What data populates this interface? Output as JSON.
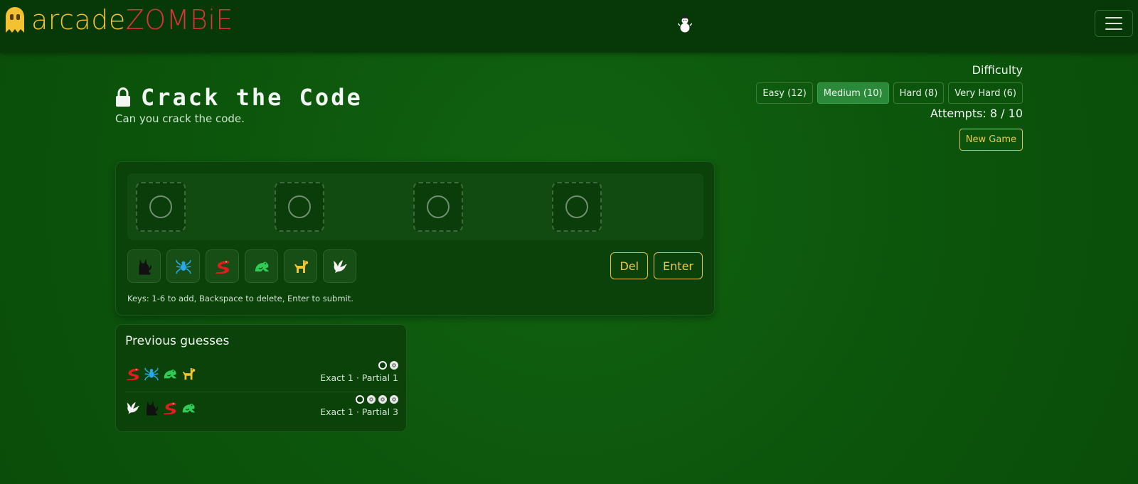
{
  "brand": {
    "part1": "arcade",
    "part2": "ZOMBiE",
    "color1": "#f2c230",
    "color2": "#d9343b"
  },
  "header": {
    "center_icon": "snowman-icon",
    "menu_icon": "hamburger-icon"
  },
  "game": {
    "title": "Crack the Code",
    "title_icon": "lock-icon",
    "subtitle": "Can you crack the code.",
    "difficulty_label": "Difficulty",
    "difficulties": [
      {
        "label": "Easy (12)",
        "active": false
      },
      {
        "label": "Medium (10)",
        "active": true
      },
      {
        "label": "Hard (8)",
        "active": false
      },
      {
        "label": "Very Hard (6)",
        "active": false
      }
    ],
    "attempts_text": "Attempts: 8 / 10",
    "new_game_label": "New Game",
    "slots_count": 4,
    "symbols": [
      {
        "name": "cat",
        "color": "#111111"
      },
      {
        "name": "spider",
        "color": "#2aa7e6"
      },
      {
        "name": "snake",
        "color": "#e11d1d"
      },
      {
        "name": "frog",
        "color": "#2ecc55"
      },
      {
        "name": "dog",
        "color": "#f2c230"
      },
      {
        "name": "dove",
        "color": "#f4f4f4"
      }
    ],
    "delete_label": "Del",
    "enter_label": "Enter",
    "hint": "Keys: 1-6 to add, Backspace to delete, Enter to submit."
  },
  "history": {
    "title": "Previous guesses",
    "guesses": [
      {
        "symbols": [
          "snake",
          "spider",
          "frog",
          "dog"
        ],
        "exact": 1,
        "partial": 1,
        "text": "Exact 1 · Partial 1"
      },
      {
        "symbols": [
          "dove",
          "cat",
          "snake",
          "frog"
        ],
        "exact": 1,
        "partial": 3,
        "text": "Exact 1 · Partial 3"
      }
    ]
  }
}
